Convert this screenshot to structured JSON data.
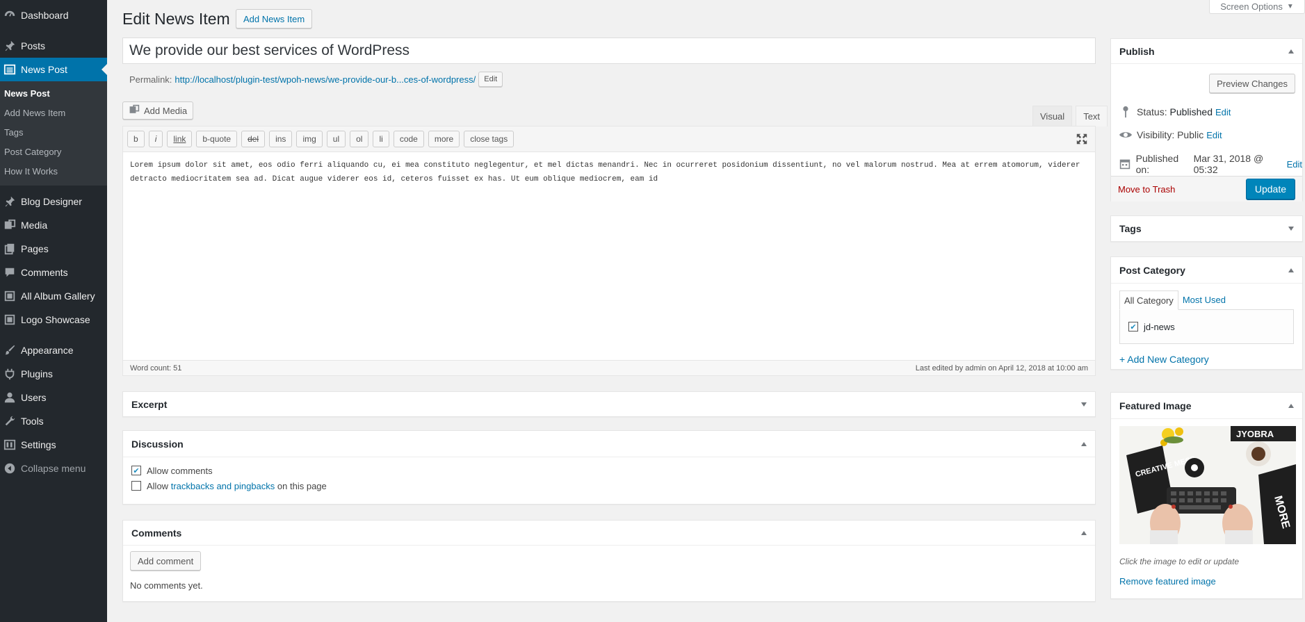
{
  "sidebar": {
    "items": [
      {
        "label": "Dashboard",
        "icon": "dashboard-icon"
      },
      {
        "label": "Posts",
        "icon": "pin-icon"
      },
      {
        "label": "News Post",
        "icon": "list-icon"
      },
      {
        "label": "Blog Designer",
        "icon": "pin-icon"
      },
      {
        "label": "Media",
        "icon": "media-icon"
      },
      {
        "label": "Pages",
        "icon": "pages-icon"
      },
      {
        "label": "Comments",
        "icon": "comment-icon"
      },
      {
        "label": "All Album Gallery",
        "icon": "gallery-icon"
      },
      {
        "label": "Logo Showcase",
        "icon": "gallery-icon"
      },
      {
        "label": "Appearance",
        "icon": "brush-icon"
      },
      {
        "label": "Plugins",
        "icon": "plugin-icon"
      },
      {
        "label": "Users",
        "icon": "user-icon"
      },
      {
        "label": "Tools",
        "icon": "wrench-icon"
      },
      {
        "label": "Settings",
        "icon": "settings-icon"
      },
      {
        "label": "Collapse menu",
        "icon": "collapse-icon"
      }
    ],
    "submenu": [
      "News Post",
      "Add News Item",
      "Tags",
      "Post Category",
      "How It Works"
    ]
  },
  "header": {
    "title": "Edit News Item",
    "add_new": "Add News Item",
    "screen_options": "Screen Options"
  },
  "post": {
    "title": "We provide our best services of WordPress",
    "permalink_label": "Permalink:",
    "permalink_url": "http://localhost/plugin-test/wpoh-news/we-provide-our-b...ces-of-wordpress/",
    "permalink_edit": "Edit"
  },
  "editor": {
    "add_media": "Add Media",
    "tab_visual": "Visual",
    "tab_text": "Text",
    "quicktags": [
      "b",
      "i",
      "link",
      "b-quote",
      "del",
      "ins",
      "img",
      "ul",
      "ol",
      "li",
      "code",
      "more",
      "close tags"
    ],
    "content": "Lorem ipsum dolor sit amet, eos odio ferri aliquando cu, ei mea constituto neglegentur, et mel dictas menandri. Nec in ocurreret posidonium dissentiunt, no vel malorum nostrud. Mea at errem atomorum, viderer detracto mediocritatem sea ad. Dicat augue viderer eos id, ceteros fuisset ex has. Ut eum oblique mediocrem, eam id",
    "word_count": "Word count: 51",
    "last_edited": "Last edited by admin on April 12, 2018 at 10:00 am"
  },
  "excerpt": {
    "title": "Excerpt"
  },
  "discussion": {
    "title": "Discussion",
    "allow_comments": "Allow comments",
    "allow_prefix": "Allow",
    "trackbacks_link": "trackbacks and pingbacks",
    "allow_suffix": "on this page"
  },
  "comments": {
    "title": "Comments",
    "add_comment": "Add comment",
    "none": "No comments yet."
  },
  "publish": {
    "title": "Publish",
    "preview": "Preview Changes",
    "status_label": "Status:",
    "status_value": "Published",
    "visibility_label": "Visibility:",
    "visibility_value": "Public",
    "published_label": "Published on:",
    "published_value": "Mar 31, 2018 @ 05:32",
    "edit": "Edit",
    "trash": "Move to Trash",
    "update": "Update"
  },
  "tags_box": {
    "title": "Tags"
  },
  "category": {
    "title": "Post Category",
    "tab_all": "All Category",
    "tab_most": "Most Used",
    "item": "jd-news",
    "add_new": "+ Add New Category"
  },
  "featured": {
    "title": "Featured Image",
    "image_text_1": "CREATIVE MESS",
    "image_text_2": "JYOBRA",
    "image_text_3": "MORE",
    "caption": "Click the image to edit or update",
    "remove": "Remove featured image"
  },
  "colors": {
    "sidebar_bg": "#23282d",
    "accent": "#0073aa",
    "update_button": "#0085ba",
    "trash": "#a00"
  }
}
